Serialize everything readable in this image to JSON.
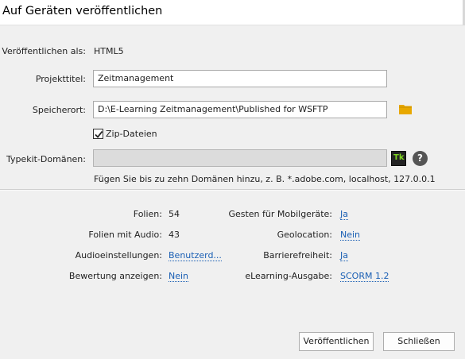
{
  "dialog": {
    "title": "Auf Geräten veröffentlichen",
    "publish_as_label": "Veröffentlichen als:",
    "publish_as_value": "HTML5",
    "project_title_label": "Projekttitel:",
    "project_title_value": "Zeitmanagement",
    "location_label": "Speicherort:",
    "location_value": "D:\\E-Learning Zeitmanagement\\Published for WSFTP",
    "zip_label": "Zip-Dateien",
    "zip_checked": true,
    "typekit_label": "Typekit-Domänen:",
    "typekit_value": "",
    "typekit_icon_text": "Tk",
    "help_icon_text": "?",
    "typekit_hint": "Fügen Sie bis zu zehn Domänen hinzu, z. B. *.adobe.com, localhost, 127.0.0.1"
  },
  "summary": {
    "slides_label": "Folien:",
    "slides_value": "54",
    "slides_audio_label": "Folien mit Audio:",
    "slides_audio_value": "43",
    "audio_settings_label": "Audioeinstellungen:",
    "audio_settings_value": "Benutzerd...",
    "show_rating_label": "Bewertung anzeigen:",
    "show_rating_value": "Nein",
    "gestures_label": "Gesten für Mobilgeräte:",
    "gestures_value": "Ja",
    "geolocation_label": "Geolocation:",
    "geolocation_value": "Nein",
    "accessibility_label": "Barrierefreiheit:",
    "accessibility_value": "Ja",
    "elearning_label": "eLearning-Ausgabe:",
    "elearning_value": "SCORM 1.2"
  },
  "buttons": {
    "publish": "Veröffentlichen",
    "close": "Schließen"
  },
  "colors": {
    "link": "#1a5fb4",
    "folder": "#e8a800",
    "typekit_green": "#7ed321"
  },
  "icons": {
    "folder": "folder-icon",
    "checkmark": "checkmark-icon",
    "typekit": "typekit-icon",
    "help": "help-icon"
  }
}
